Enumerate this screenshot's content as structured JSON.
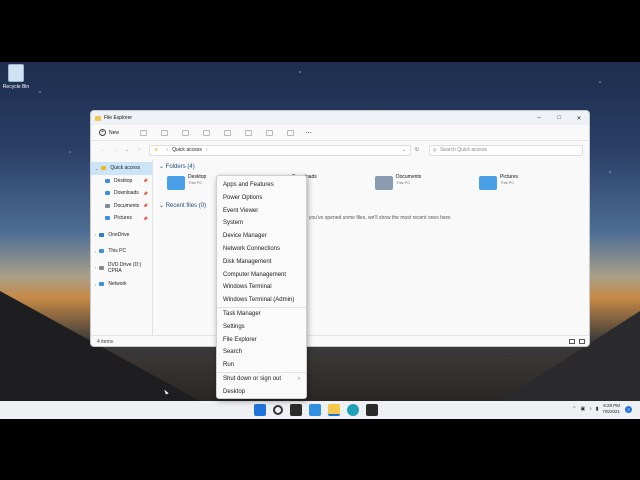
{
  "desktop": {
    "recycle_bin_label": "Recycle Bin"
  },
  "explorer": {
    "title": "File Explorer",
    "toolbar": {
      "new_label": "New"
    },
    "address": {
      "location": "Quick access",
      "search_placeholder": "Search Quick access"
    },
    "nav": [
      {
        "label": "Quick access",
        "color": "#f2b824"
      },
      {
        "label": "Desktop",
        "color": "#3b8fd9"
      },
      {
        "label": "Downloads",
        "color": "#3b8fd9"
      },
      {
        "label": "Documents",
        "color": "#7b8a99"
      },
      {
        "label": "Pictures",
        "color": "#3b8fd9"
      },
      {
        "label": "OneDrive",
        "color": "#2f7ad0"
      },
      {
        "label": "This PC",
        "color": "#3b8fd9"
      },
      {
        "label": "DVD Drive (D:) CPRA",
        "color": "#888888"
      },
      {
        "label": "Network",
        "color": "#3b8fd9"
      }
    ],
    "folders_heading": "Folders (4)",
    "folders": [
      {
        "name": "Desktop",
        "sub": "This PC"
      },
      {
        "name": "Downloads",
        "sub": "This PC"
      },
      {
        "name": "Documents",
        "sub": "This PC"
      },
      {
        "name": "Pictures",
        "sub": "This PC"
      }
    ],
    "recent_heading": "Recent files (0)",
    "recent_message": "After you've opened some files, we'll show the most recent ones here.",
    "status": "4 items"
  },
  "context_menu": {
    "items": [
      "Apps and Features",
      "Power Options",
      "Event Viewer",
      "System",
      "Device Manager",
      "Network Connections",
      "Disk Management",
      "Computer Management",
      "Windows Terminal",
      "Windows Terminal (Admin)",
      "Task Manager",
      "Settings",
      "File Explorer",
      "Search",
      "Run",
      "Shut down or sign out",
      "Desktop"
    ]
  },
  "taskbar": {
    "time": "9:28 PM",
    "date": "7/6/2021",
    "notification_count": "3",
    "icons": [
      "start-icon",
      "search-icon",
      "task-view-icon",
      "widgets-icon",
      "file-explorer-icon",
      "edge-icon",
      "store-icon"
    ]
  }
}
